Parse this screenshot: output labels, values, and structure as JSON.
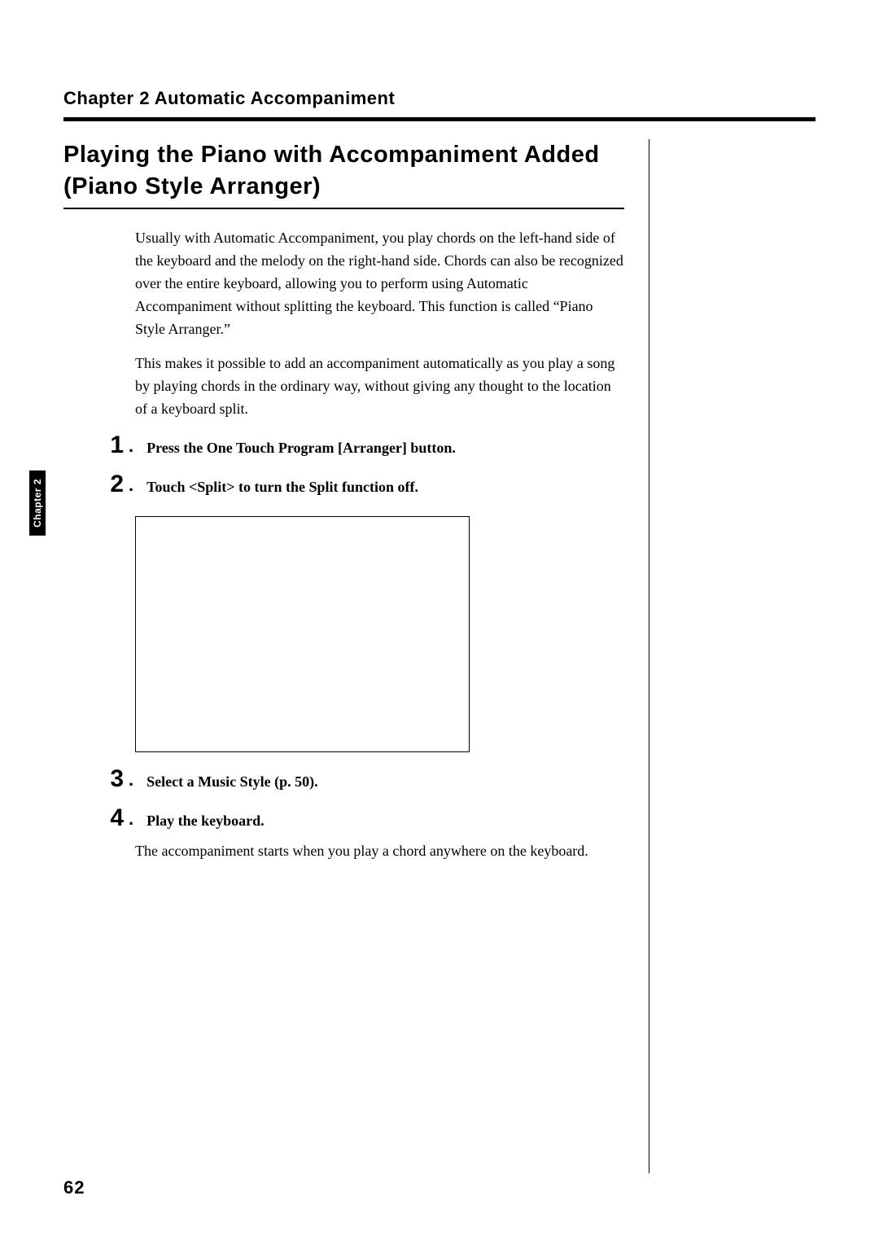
{
  "runningHeader": "Chapter 2 Automatic Accompaniment",
  "sectionTitle": "Playing the Piano with Accompaniment Added (Piano Style Arranger)",
  "intro": {
    "p1": "Usually with Automatic Accompaniment, you play chords on the left-hand side of the keyboard and the melody on the right-hand side. Chords can also be recognized over the entire keyboard, allowing you to perform using Automatic Accompaniment without splitting the keyboard. This function is called “Piano Style Arranger.”",
    "p2": "This makes it possible to add an accompaniment automatically as you play a song by playing chords in the ordinary way, without giving any thought to the location of a keyboard split."
  },
  "steps": {
    "s1": {
      "num": "1",
      "text": "Press the One Touch Program [Arranger] button."
    },
    "s2": {
      "num": "2",
      "text": "Touch <Split> to turn the Split function off."
    },
    "s3": {
      "num": "3",
      "text": "Select a Music Style (p. 50)."
    },
    "s4": {
      "num": "4",
      "text": "Play the keyboard."
    }
  },
  "afterStep4": "The accompaniment starts when you play a chord anywhere on the keyboard.",
  "sideTab": "Chapter 2",
  "pageNumber": "62"
}
